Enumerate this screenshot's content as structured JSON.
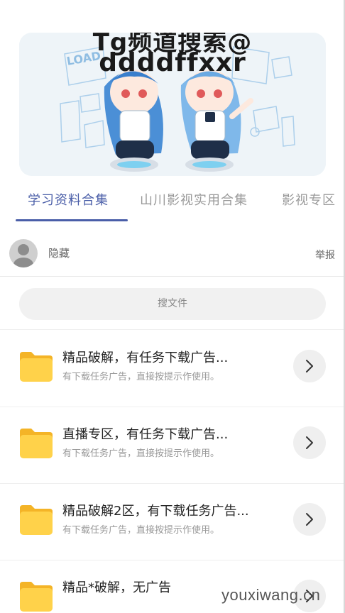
{
  "banner": {
    "text_line1": "Tg频道搜索@",
    "text_line2": "ddddffxxr",
    "loading_word": "LOAD"
  },
  "tabs": [
    {
      "label": "学习资料合集",
      "active": true
    },
    {
      "label": "山川影视实用合集",
      "active": false
    },
    {
      "label": "影视专区",
      "active": false
    }
  ],
  "user": {
    "name": "隐藏",
    "report_label": "举报"
  },
  "search": {
    "label": "搜文件"
  },
  "files": [
    {
      "title": "精品破解，有任务下载广告...",
      "desc": "有下载任务广告，直接按提示作使用。"
    },
    {
      "title": "直播专区，有任务下载广告...",
      "desc": "有下载任务广告，直接按提示作使用。"
    },
    {
      "title": "精品破解2区，有下载任务广告...",
      "desc": "有下载任务广告，直接按提示作使用。"
    },
    {
      "title": "精品*破解，无广告",
      "desc": ""
    }
  ],
  "watermark": "youxiwang.cn",
  "colors": {
    "accent": "#4a5ea8",
    "folder": "#ffd24a",
    "folder_tab": "#f4b427"
  }
}
